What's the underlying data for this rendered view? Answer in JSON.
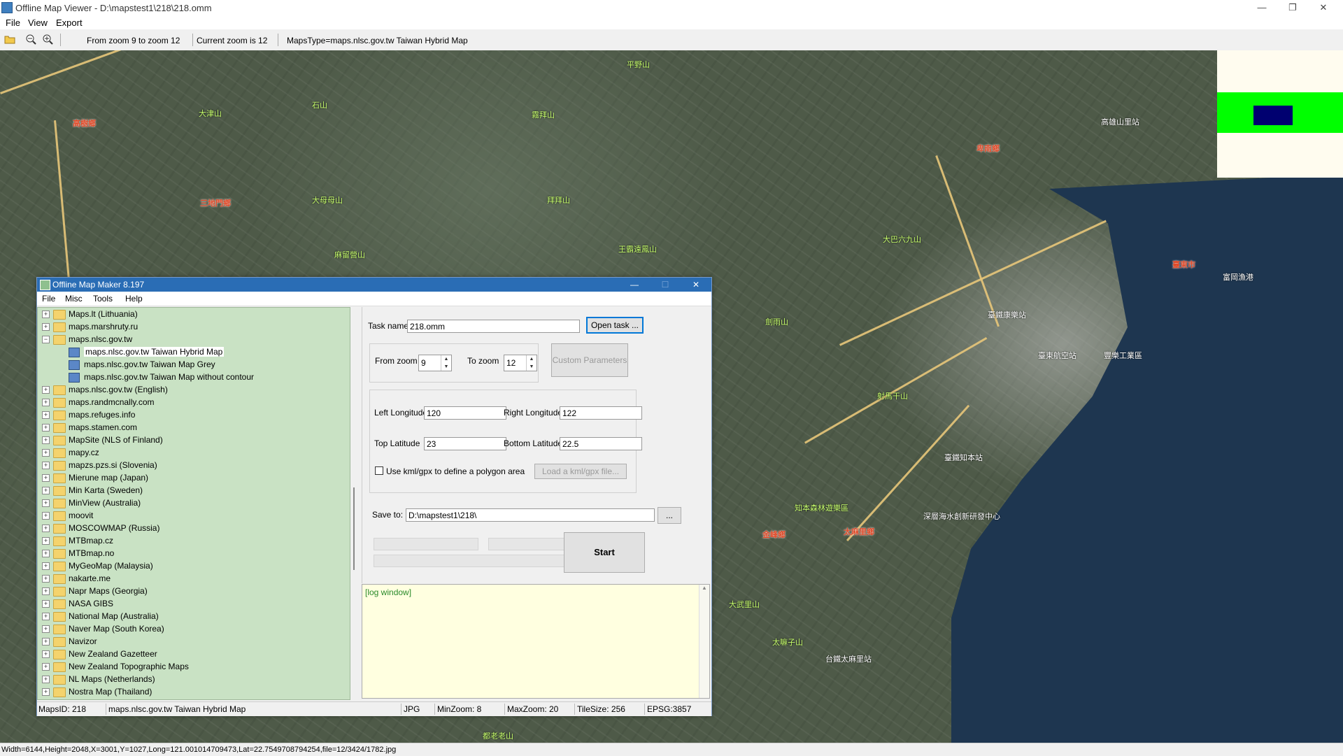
{
  "window": {
    "title": "Offline Map Viewer - D:\\mapstest1\\218\\218.omm",
    "menu": [
      "File",
      "View",
      "Export"
    ],
    "controls": {
      "minimize": "—",
      "maximize": "❐",
      "close": "✕"
    }
  },
  "toolbar": {
    "icons": [
      "open-folder-icon",
      "zoom-out-icon",
      "zoom-in-icon"
    ],
    "zoom_range": "From zoom 9 to zoom 12",
    "current_zoom": "Current zoom is 12",
    "maps_type": "MapsType=maps.nlsc.gov.tw Taiwan Hybrid Map"
  },
  "map": {
    "labels": [
      {
        "text": "平野山",
        "style": "grn"
      },
      {
        "text": "石山",
        "style": "grn"
      },
      {
        "text": "大津山",
        "style": "grn"
      },
      {
        "text": "高樹鄉",
        "style": "red"
      },
      {
        "text": "三地門鄉",
        "style": "red"
      },
      {
        "text": "大母母山",
        "style": "grn"
      },
      {
        "text": "拜拜山",
        "style": "grn"
      },
      {
        "text": "霧拜山",
        "style": "grn"
      },
      {
        "text": "王霸遠鳳山",
        "style": "grn"
      },
      {
        "text": "麻留營山",
        "style": "grn"
      },
      {
        "text": "卑南鄉",
        "style": "red"
      },
      {
        "text": "高雄山里站",
        "style": ""
      },
      {
        "text": "大巴六九山",
        "style": "grn"
      },
      {
        "text": "臺東市",
        "style": "red"
      },
      {
        "text": "富岡漁港",
        "style": ""
      },
      {
        "text": "臺鐵康樂站",
        "style": ""
      },
      {
        "text": "臺東航空站",
        "style": ""
      },
      {
        "text": "豐樂工業區",
        "style": ""
      },
      {
        "text": "臺鐵知本站",
        "style": ""
      },
      {
        "text": "射馬干山",
        "style": "grn"
      },
      {
        "text": "知本森林遊樂區",
        "style": "grn"
      },
      {
        "text": "深層海水創新研發中心",
        "style": ""
      },
      {
        "text": "金峰鄉",
        "style": "red"
      },
      {
        "text": "太麻里鄉",
        "style": "red"
      },
      {
        "text": "大武里山",
        "style": "grn"
      },
      {
        "text": "台鐵太麻里站",
        "style": ""
      },
      {
        "text": "太嘛子山",
        "style": "grn"
      },
      {
        "text": "都老老山",
        "style": "grn"
      },
      {
        "text": "劍雨山",
        "style": "grn"
      }
    ]
  },
  "maker": {
    "title": "Offline Map Maker 8.197",
    "controls": {
      "minimize": "—",
      "maximize": "☐",
      "close": "✕"
    },
    "menu": [
      "File",
      "Misc",
      "Tools",
      "Help"
    ],
    "tree": [
      {
        "label": "Maps.lt (Lithuania)",
        "level": 0,
        "type": "folder",
        "exp": "+"
      },
      {
        "label": "maps.marshruty.ru",
        "level": 0,
        "type": "folder",
        "exp": "+"
      },
      {
        "label": "maps.nlsc.gov.tw",
        "level": 0,
        "type": "folder",
        "exp": "−"
      },
      {
        "label": "maps.nlsc.gov.tw Taiwan Hybrid Map",
        "level": 1,
        "type": "map",
        "selected": true
      },
      {
        "label": "maps.nlsc.gov.tw Taiwan Map Grey",
        "level": 1,
        "type": "map"
      },
      {
        "label": "maps.nlsc.gov.tw Taiwan Map without contour",
        "level": 1,
        "type": "map"
      },
      {
        "label": "maps.nlsc.gov.tw (English)",
        "level": 0,
        "type": "folder",
        "exp": "+"
      },
      {
        "label": "maps.randmcnally.com",
        "level": 0,
        "type": "folder",
        "exp": "+"
      },
      {
        "label": "maps.refuges.info",
        "level": 0,
        "type": "folder",
        "exp": "+"
      },
      {
        "label": "maps.stamen.com",
        "level": 0,
        "type": "folder",
        "exp": "+"
      },
      {
        "label": "MapSite (NLS of Finland)",
        "level": 0,
        "type": "folder",
        "exp": "+"
      },
      {
        "label": "mapy.cz",
        "level": 0,
        "type": "folder",
        "exp": "+"
      },
      {
        "label": "mapzs.pzs.si (Slovenia)",
        "level": 0,
        "type": "folder",
        "exp": "+"
      },
      {
        "label": "Mierune map (Japan)",
        "level": 0,
        "type": "folder",
        "exp": "+"
      },
      {
        "label": "Min Karta (Sweden)",
        "level": 0,
        "type": "folder",
        "exp": "+"
      },
      {
        "label": "MinView (Australia)",
        "level": 0,
        "type": "folder",
        "exp": "+"
      },
      {
        "label": "moovit",
        "level": 0,
        "type": "folder",
        "exp": "+"
      },
      {
        "label": "MOSCOWMAP (Russia)",
        "level": 0,
        "type": "folder",
        "exp": "+"
      },
      {
        "label": "MTBmap.cz",
        "level": 0,
        "type": "folder",
        "exp": "+"
      },
      {
        "label": "MTBmap.no",
        "level": 0,
        "type": "folder",
        "exp": "+"
      },
      {
        "label": "MyGeoMap (Malaysia)",
        "level": 0,
        "type": "folder",
        "exp": "+"
      },
      {
        "label": "nakarte.me",
        "level": 0,
        "type": "folder",
        "exp": "+"
      },
      {
        "label": "Napr Maps (Georgia)",
        "level": 0,
        "type": "folder",
        "exp": "+"
      },
      {
        "label": "NASA GIBS",
        "level": 0,
        "type": "folder",
        "exp": "+"
      },
      {
        "label": "National Map (Australia)",
        "level": 0,
        "type": "folder",
        "exp": "+"
      },
      {
        "label": "Naver Map (South Korea)",
        "level": 0,
        "type": "folder",
        "exp": "+"
      },
      {
        "label": "Navizor",
        "level": 0,
        "type": "folder",
        "exp": "+"
      },
      {
        "label": "New Zealand Gazetteer",
        "level": 0,
        "type": "folder",
        "exp": "+"
      },
      {
        "label": "New Zealand Topographic Maps",
        "level": 0,
        "type": "folder",
        "exp": "+"
      },
      {
        "label": "NL Maps (Netherlands)",
        "level": 0,
        "type": "folder",
        "exp": "+"
      },
      {
        "label": "Nostra Map (Thailand)",
        "level": 0,
        "type": "folder",
        "exp": "+"
      }
    ],
    "form": {
      "task_name_label": "Task name",
      "task_name_value": "218.omm",
      "open_task": "Open task ...",
      "from_zoom_label": "From zoom",
      "from_zoom_value": "9",
      "to_zoom_label": "To zoom",
      "to_zoom_value": "12",
      "custom_params": "Custom Parameters",
      "left_lon_label": "Left Longitude",
      "left_lon_value": "120",
      "right_lon_label": "Right Longitude",
      "right_lon_value": "122",
      "top_lat_label": "Top Latitude",
      "top_lat_value": "23",
      "bottom_lat_label": "Bottom Latitude",
      "bottom_lat_value": "22.5",
      "kml_label": "Use kml/gpx to define a polygon area",
      "kml_checked": false,
      "load_kml": "Load a kml/gpx file...",
      "save_to_label": "Save to:",
      "save_to_value": "D:\\mapstest1\\218\\",
      "browse": "...",
      "start": "Start"
    },
    "log": "[log window]",
    "status": {
      "maps_id": "MapsID: 218",
      "map_name": "maps.nlsc.gov.tw Taiwan Hybrid Map",
      "format": "JPG",
      "min_zoom": "MinZoom: 8",
      "max_zoom": "MaxZoom: 20",
      "tile_size": "TileSize: 256",
      "epsg": "EPSG:3857"
    }
  },
  "statusbar": "Width=6144,Height=2048,X=3001,Y=1027,Long=121.001014709473,Lat=22.7549708794254,file=12/3424/1782.jpg"
}
